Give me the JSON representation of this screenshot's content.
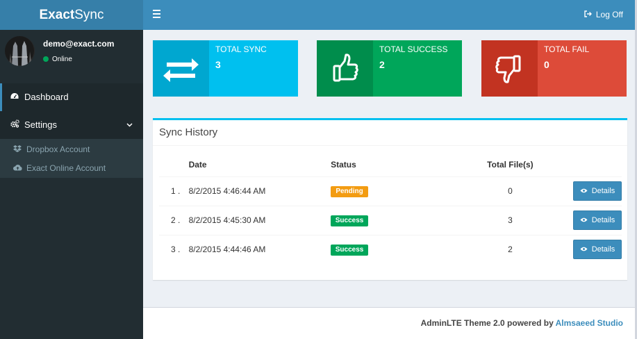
{
  "app": {
    "name_bold": "Exact",
    "name_rest": "Sync"
  },
  "header": {
    "logoff_label": "Log Off"
  },
  "user": {
    "email": "demo@exact.com",
    "status": "Online"
  },
  "sidebar": {
    "items": [
      {
        "label": "Dashboard",
        "icon": "dashboard-icon"
      },
      {
        "label": "Settings",
        "icon": "cogs-icon"
      }
    ],
    "subitems": [
      {
        "label": "Dropbox Account",
        "icon": "dropbox-icon"
      },
      {
        "label": "Exact Online Account",
        "icon": "cloud-upload-icon"
      }
    ]
  },
  "stats": [
    {
      "label": "TOTAL SYNC",
      "value": "3",
      "color": "#00c0ef",
      "icon_bg": "#00a7d0",
      "icon": "exchange-icon"
    },
    {
      "label": "TOTAL SUCCESS",
      "value": "2",
      "color": "#00a65a",
      "icon_bg": "#008d4c",
      "icon": "thumbs-up-icon"
    },
    {
      "label": "TOTAL FAIL",
      "value": "0",
      "color": "#dd4b39",
      "icon_bg": "#c23321",
      "icon": "thumbs-down-icon"
    }
  ],
  "history": {
    "title": "Sync History",
    "columns": [
      "Date",
      "Status",
      "Total File(s)"
    ],
    "rows": [
      {
        "no": "1 .",
        "date": "8/2/2015 4:46:44 AM",
        "status": "Pending",
        "files": "0",
        "action": "Details"
      },
      {
        "no": "2 .",
        "date": "8/2/2015 4:45:30 AM",
        "status": "Success",
        "files": "3",
        "action": "Details"
      },
      {
        "no": "3 .",
        "date": "8/2/2015 4:44:46 AM",
        "status": "Success",
        "files": "2",
        "action": "Details"
      }
    ]
  },
  "footer": {
    "text": "AdminLTE Theme 2.0 powered by",
    "link": "Almsaeed Studio"
  }
}
